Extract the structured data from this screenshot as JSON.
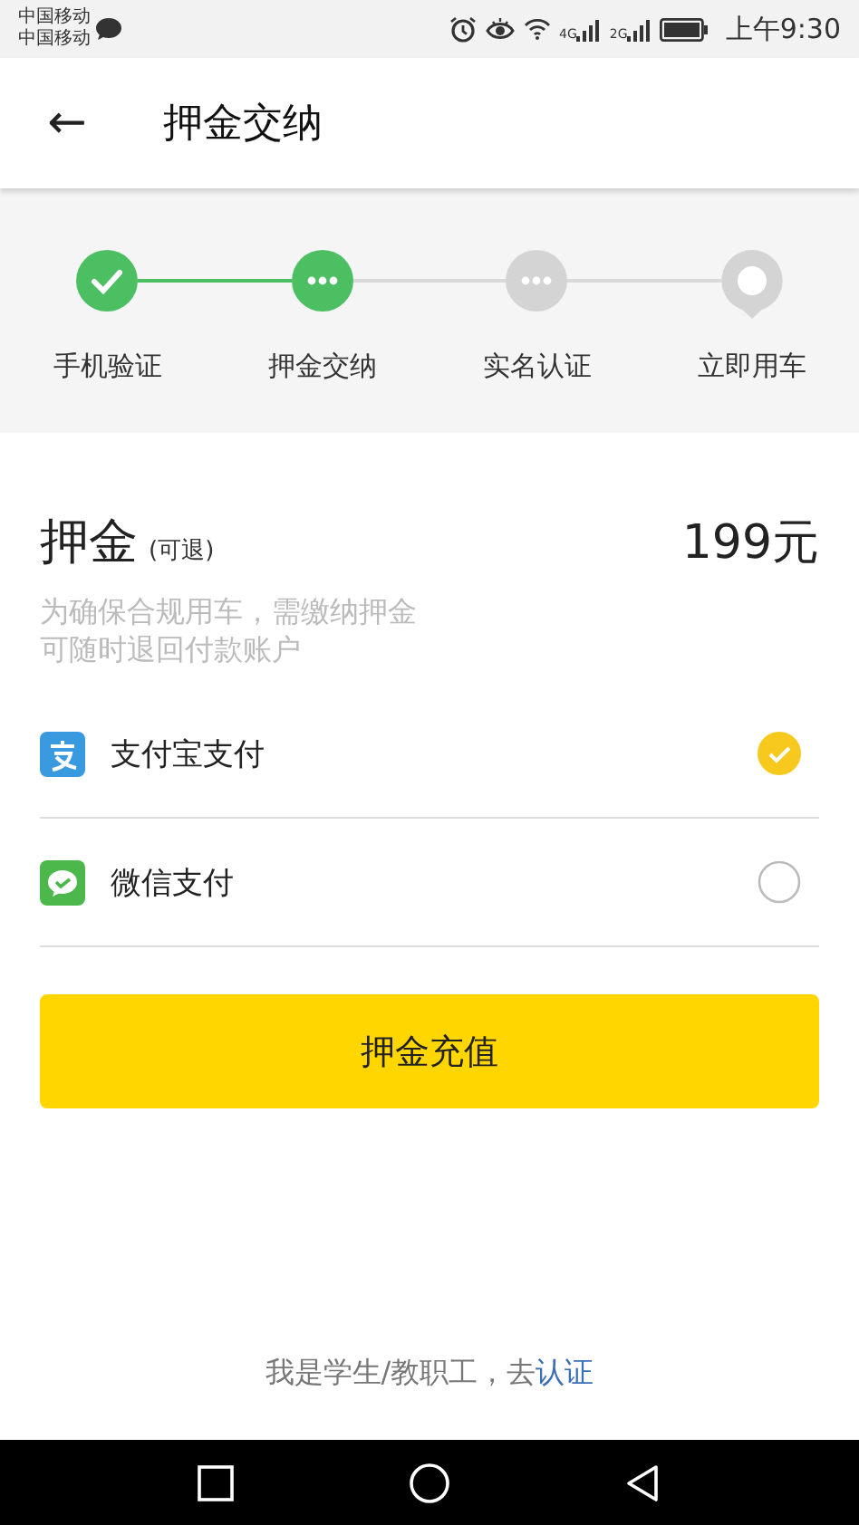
{
  "status_bar": {
    "carriers": [
      "中国移动",
      "中国移动"
    ],
    "network_labels": [
      "4G",
      "2G"
    ],
    "time": "上午9:30"
  },
  "header": {
    "back_icon": "←",
    "title": "押金交纳"
  },
  "steps": [
    {
      "label": "手机验证",
      "reached": true,
      "kind": "check"
    },
    {
      "label": "押金交纳",
      "reached": true,
      "kind": "dots"
    },
    {
      "label": "实名认证",
      "reached": false,
      "kind": "dots"
    },
    {
      "label": "立即用车",
      "reached": false,
      "kind": "pin"
    }
  ],
  "deposit": {
    "title": "押金",
    "note": "(可退)",
    "amount": "199元",
    "description": [
      "为确保合规用车，需缴纳押金",
      "可随时退回付款账户"
    ]
  },
  "payment_methods": [
    {
      "kind": "alipay",
      "label": "支付宝支付",
      "selected": true
    },
    {
      "kind": "wechat",
      "label": "微信支付",
      "selected": false
    }
  ],
  "submit_button": "押金充值",
  "footer": {
    "text": "我是学生/教职工，去",
    "link": "认证"
  }
}
